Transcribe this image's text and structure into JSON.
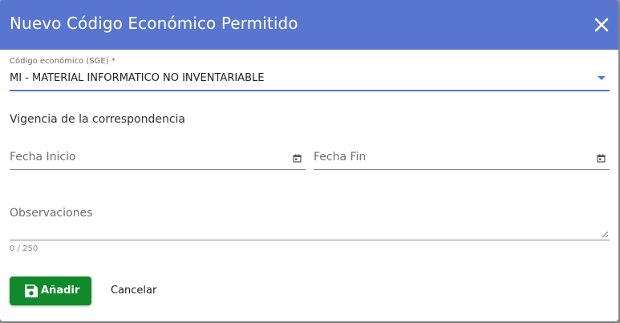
{
  "dialog": {
    "title": "Nuevo Código Económico Permitido",
    "close_icon": "close-icon"
  },
  "form": {
    "codigo": {
      "label": "Código económico (SGE) *",
      "value": "MI - MATERIAL INFORMATICO NO INVENTARIABLE",
      "icon": "chevron-down-icon"
    },
    "vigencia_title": "Vigencia de la correspondencia",
    "fecha_inicio": {
      "label": "Fecha Inicio",
      "icon": "calendar-icon"
    },
    "fecha_fin": {
      "label": "Fecha Fin",
      "icon": "calendar-icon"
    },
    "observaciones": {
      "label": "Observaciones",
      "counter": "0 / 250"
    }
  },
  "actions": {
    "save_label": "Añadir",
    "save_icon": "save-icon",
    "cancel_label": "Cancelar"
  },
  "colors": {
    "header": "#5876cf",
    "accent": "#5876cf",
    "save_button": "#118a2b"
  }
}
